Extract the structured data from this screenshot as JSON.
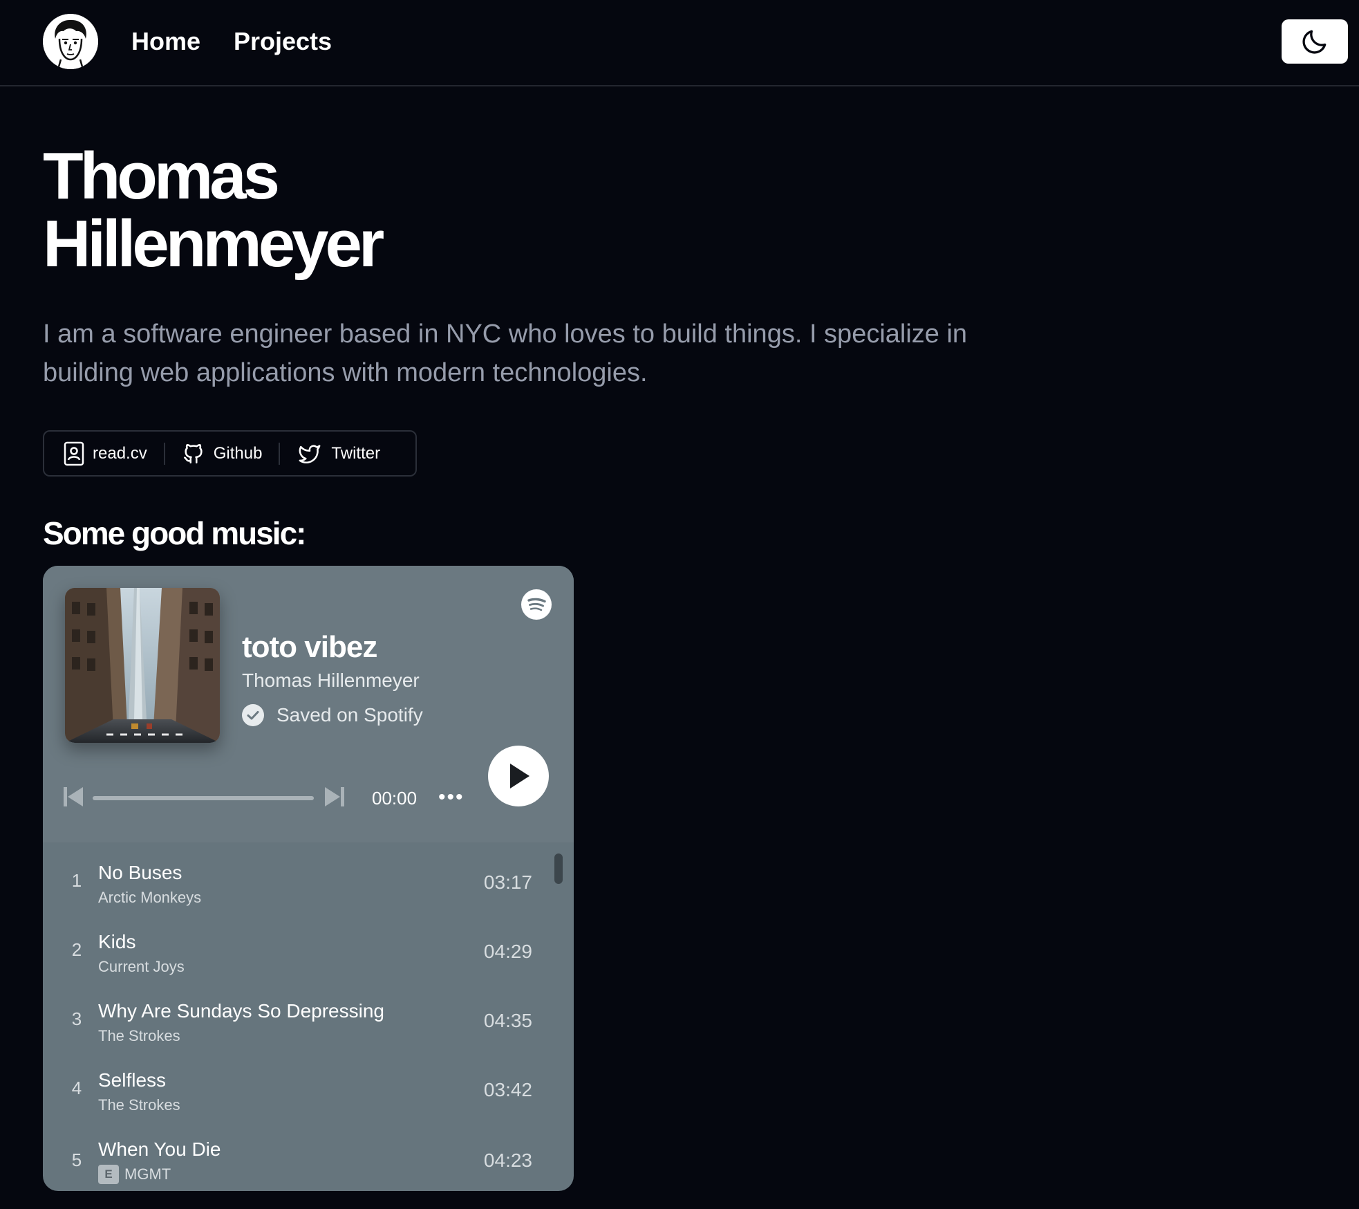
{
  "nav": {
    "home": "Home",
    "projects": "Projects"
  },
  "hero": {
    "first_name": "Thomas",
    "last_name": "Hillenmeyer",
    "bio": "I am a software engineer based in NYC who loves to build things. I specialize in building web applications with modern technologies."
  },
  "social": [
    {
      "label": "read.cv",
      "icon": "contact-card-icon"
    },
    {
      "label": "Github",
      "icon": "github-icon"
    },
    {
      "label": "Twitter",
      "icon": "twitter-icon"
    }
  ],
  "music": {
    "heading": "Some good music:",
    "playlist": {
      "title": "toto vibez",
      "owner": "Thomas Hillenmeyer",
      "saved": "Saved on Spotify",
      "time": "00:00",
      "more": "•••",
      "progress": 0
    },
    "tracks": [
      {
        "num": "1",
        "name": "No Buses",
        "artist": "Arctic Monkeys",
        "duration": "03:17",
        "explicit": false
      },
      {
        "num": "2",
        "name": "Kids",
        "artist": "Current Joys",
        "duration": "04:29",
        "explicit": false
      },
      {
        "num": "3",
        "name": "Why Are Sundays So Depressing",
        "artist": "The Strokes",
        "duration": "04:35",
        "explicit": false
      },
      {
        "num": "4",
        "name": "Selfless",
        "artist": "The Strokes",
        "duration": "03:42",
        "explicit": false
      },
      {
        "num": "5",
        "name": "When You Die",
        "artist": "MGMT",
        "duration": "04:23",
        "explicit": true,
        "explicit_label": "E"
      }
    ]
  },
  "colors": {
    "background": "#05070f",
    "player_bg": "#66757d",
    "muted_text": "#969cab"
  }
}
